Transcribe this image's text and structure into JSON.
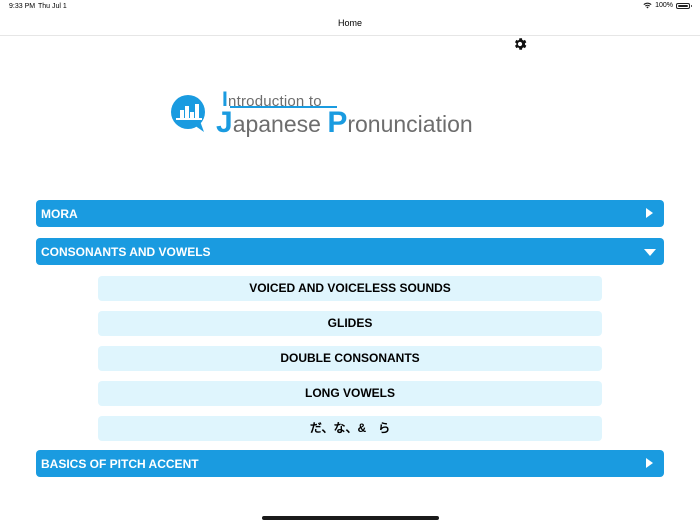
{
  "status_bar": {
    "time": "9:33 PM",
    "date": "Thu Jul 1",
    "battery": "100%"
  },
  "nav": {
    "title": "Home",
    "settings_icon": "gear-icon"
  },
  "logo": {
    "line1_initial": "I",
    "line1_rest": "ntroduction to",
    "line2_j": "J",
    "line2_rest": "apanese ",
    "line2_p": "P",
    "line2_rest2": "ronunciation"
  },
  "sections": [
    {
      "label": "MORA",
      "state": "collapsed"
    },
    {
      "label": "CONSONANTS AND VOWELS",
      "state": "expanded"
    },
    {
      "label": "BASICS OF PITCH ACCENT",
      "state": "collapsed"
    }
  ],
  "subitems": [
    "VOICED AND VOICELESS SOUNDS",
    "GLIDES",
    "DOUBLE CONSONANTS",
    "LONG VOWELS",
    "だ、な、&　ら"
  ],
  "colors": {
    "accent": "#1a9be0",
    "subitem_bg": "#dff5fd",
    "logo_gray": "#6d6d6d"
  }
}
